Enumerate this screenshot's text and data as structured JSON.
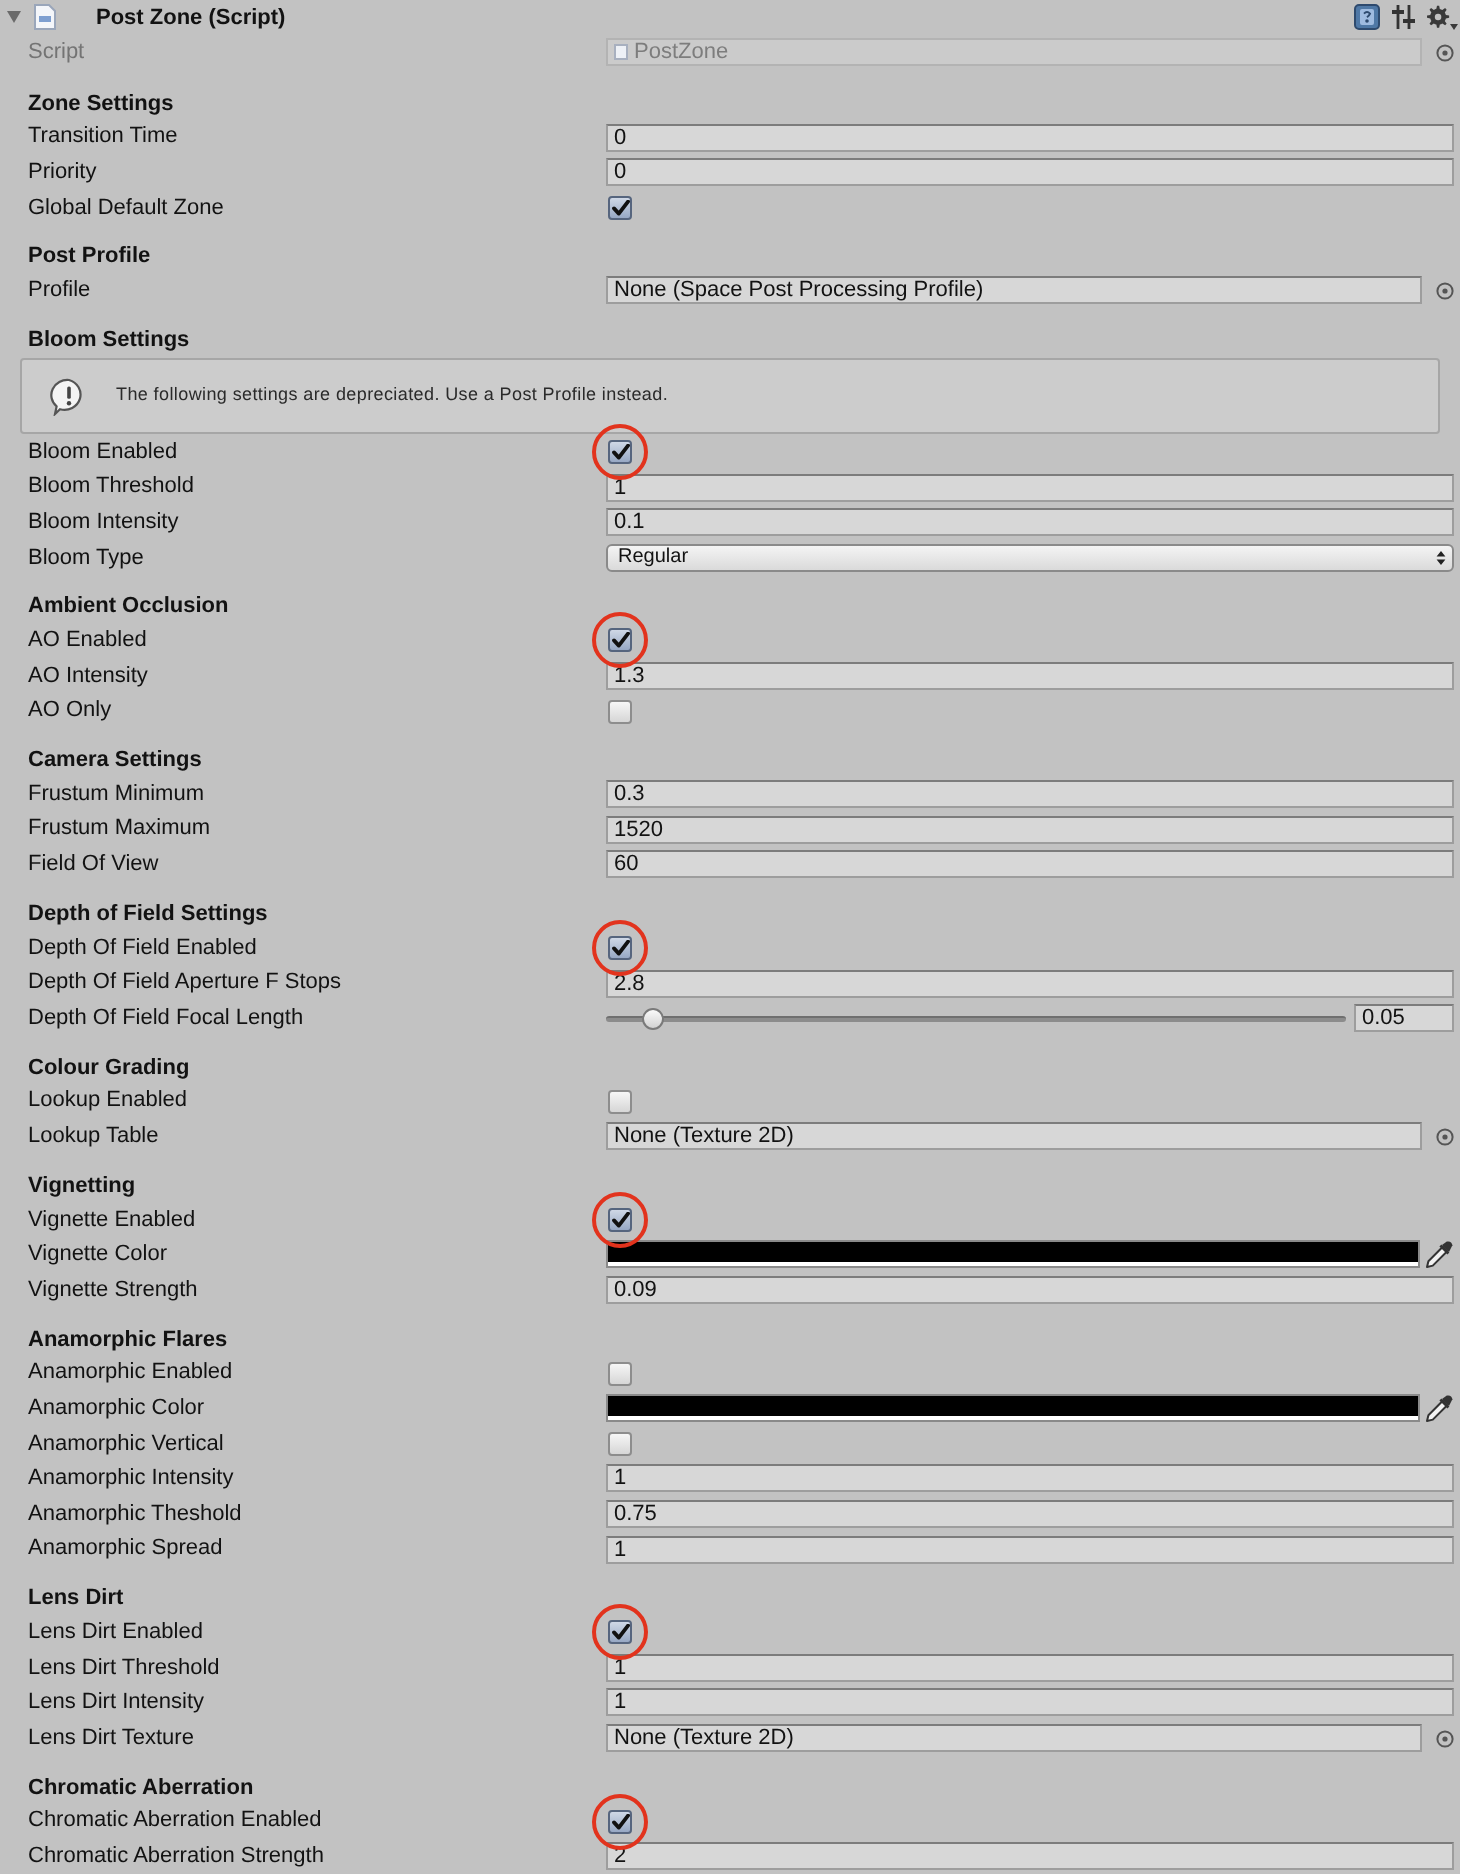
{
  "component": {
    "title": "Post Zone (Script)",
    "expanded": true
  },
  "script": {
    "label": "Script",
    "value": "PostZone",
    "disabled": true
  },
  "sections": [
    {
      "title": "Zone Settings",
      "rows": [
        {
          "kind": "field",
          "label": "Transition Time",
          "value": "0"
        },
        {
          "kind": "field",
          "label": "Priority",
          "value": "0"
        },
        {
          "kind": "checkbox",
          "label": "Global Default Zone",
          "checked": true,
          "circled": false
        }
      ]
    },
    {
      "title": "Post Profile",
      "rows": [
        {
          "kind": "object",
          "label": "Profile",
          "value": "None (Space Post Processing Profile)"
        }
      ]
    },
    {
      "title": "Bloom Settings",
      "notice": "The following settings are depreciated. Use a Post Profile instead.",
      "rows": [
        {
          "kind": "checkbox",
          "label": "Bloom Enabled",
          "checked": true,
          "circled": true
        },
        {
          "kind": "field",
          "label": "Bloom Threshold",
          "value": "1"
        },
        {
          "kind": "field",
          "label": "Bloom Intensity",
          "value": "0.1"
        },
        {
          "kind": "dropdown",
          "label": "Bloom Type",
          "value": "Regular"
        }
      ]
    },
    {
      "title": "Ambient Occlusion",
      "rows": [
        {
          "kind": "checkbox",
          "label": "AO Enabled",
          "checked": true,
          "circled": true
        },
        {
          "kind": "field",
          "label": "AO Intensity",
          "value": "1.3"
        },
        {
          "kind": "checkbox",
          "label": "AO Only",
          "checked": false,
          "circled": false
        }
      ]
    },
    {
      "title": "Camera Settings",
      "rows": [
        {
          "kind": "field",
          "label": "Frustum Minimum",
          "value": "0.3"
        },
        {
          "kind": "field",
          "label": "Frustum Maximum",
          "value": "1520"
        },
        {
          "kind": "field",
          "label": "Field Of View",
          "value": "60"
        }
      ]
    },
    {
      "title": "Depth of Field Settings",
      "rows": [
        {
          "kind": "checkbox",
          "label": "Depth Of Field Enabled",
          "checked": true,
          "circled": true
        },
        {
          "kind": "field",
          "label": "Depth Of Field Aperture F Stops",
          "value": "2.8"
        },
        {
          "kind": "slider",
          "label": "Depth Of Field Focal Length",
          "level": 0.05,
          "value": "0.05"
        }
      ]
    },
    {
      "title": "Colour Grading",
      "rows": [
        {
          "kind": "checkbox",
          "label": "Lookup Enabled",
          "checked": false,
          "circled": false
        },
        {
          "kind": "object",
          "label": "Lookup Table",
          "value": "None (Texture 2D)"
        }
      ]
    },
    {
      "title": "Vignetting",
      "rows": [
        {
          "kind": "checkbox",
          "label": "Vignette Enabled",
          "checked": true,
          "circled": true
        },
        {
          "kind": "color",
          "label": "Vignette Color",
          "color": "#000000"
        },
        {
          "kind": "field",
          "label": "Vignette Strength",
          "value": "0.09"
        }
      ]
    },
    {
      "title": "Anamorphic Flares",
      "rows": [
        {
          "kind": "checkbox",
          "label": "Anamorphic Enabled",
          "checked": false,
          "circled": false
        },
        {
          "kind": "color",
          "label": "Anamorphic Color",
          "color": "#000000"
        },
        {
          "kind": "checkbox",
          "label": "Anamorphic Vertical",
          "checked": false,
          "circled": false
        },
        {
          "kind": "field",
          "label": "Anamorphic Intensity",
          "value": "1"
        },
        {
          "kind": "field",
          "label": "Anamorphic Theshold",
          "value": "0.75"
        },
        {
          "kind": "field",
          "label": "Anamorphic Spread",
          "value": "1"
        }
      ]
    },
    {
      "title": "Lens Dirt",
      "rows": [
        {
          "kind": "checkbox",
          "label": "Lens Dirt Enabled",
          "checked": true,
          "circled": true
        },
        {
          "kind": "field",
          "label": "Lens Dirt Threshold",
          "value": "1"
        },
        {
          "kind": "field",
          "label": "Lens Dirt Intensity",
          "value": "1"
        },
        {
          "kind": "object",
          "label": "Lens Dirt Texture",
          "value": "None (Texture 2D)"
        }
      ]
    },
    {
      "title": "Chromatic Aberration",
      "rows": [
        {
          "kind": "checkbox",
          "label": "Chromatic Aberration Enabled",
          "checked": true,
          "circled": true
        },
        {
          "kind": "field",
          "label": "Chromatic Aberration Strength",
          "value": "2"
        }
      ]
    }
  ]
}
